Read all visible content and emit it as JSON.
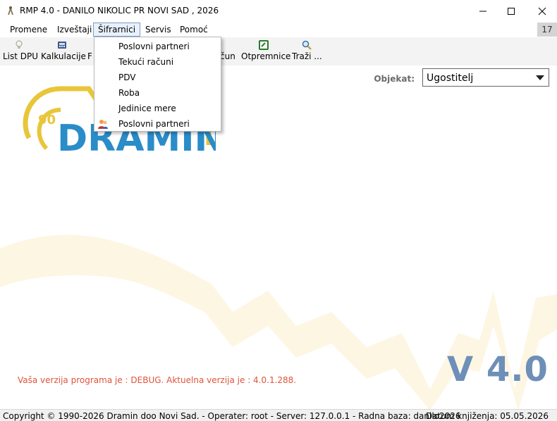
{
  "window": {
    "title": "RMP 4.0 - DANILO NIKOLIC PR NOVI SAD , 2026",
    "minimize_icon": "minimize-icon",
    "maximize_icon": "maximize-icon",
    "close_icon": "close-icon"
  },
  "menubar": {
    "items": [
      {
        "label": "Promene"
      },
      {
        "label": "Izveštaji"
      },
      {
        "label": "Šifrarnici"
      },
      {
        "label": "Servis"
      },
      {
        "label": "Pomoć"
      }
    ],
    "mdi_count": "17"
  },
  "toolbar": {
    "items": [
      {
        "label": "List DPU",
        "icon": "lightbulb-icon"
      },
      {
        "label": "Kalkulacije",
        "icon": "calculator-icon"
      },
      {
        "label": "F",
        "icon": ""
      },
      {
        "label": "čun",
        "icon": ""
      },
      {
        "label": "Otpremnice",
        "icon": "clipboard-icon"
      },
      {
        "label": "Traži ...",
        "icon": "search-icon"
      }
    ]
  },
  "dropdown": {
    "items": [
      {
        "label": "Poslovni partneri"
      },
      {
        "label": "Tekući računi"
      },
      {
        "label": "PDV"
      },
      {
        "label": "Roba"
      },
      {
        "label": "Jedinice mere"
      },
      {
        "label": "Poslovni partneri",
        "icon": "users-icon"
      }
    ]
  },
  "objekat": {
    "label": "Objekat:",
    "value": "Ugostitelj"
  },
  "logo": {
    "number": "90",
    "text": "DRAMIN"
  },
  "version": {
    "note": "Vaša verzija programa je : DEBUG. Aktuelna verzija je : 4.0.1.288.",
    "big": "V 4.0"
  },
  "status": {
    "left": "Copyright © 1990-2026 Dramin doo Novi Sad. - Operater: root - Server: 127.0.0.1 - Radna baza: danilo2026",
    "right": "Datum knjiženja: 05.05.2026"
  },
  "colors": {
    "accent_blue": "#2a8cc8",
    "logo_yellow": "#e8c63a",
    "version_text": "#6e8fb7",
    "note_red": "#e0533a"
  }
}
